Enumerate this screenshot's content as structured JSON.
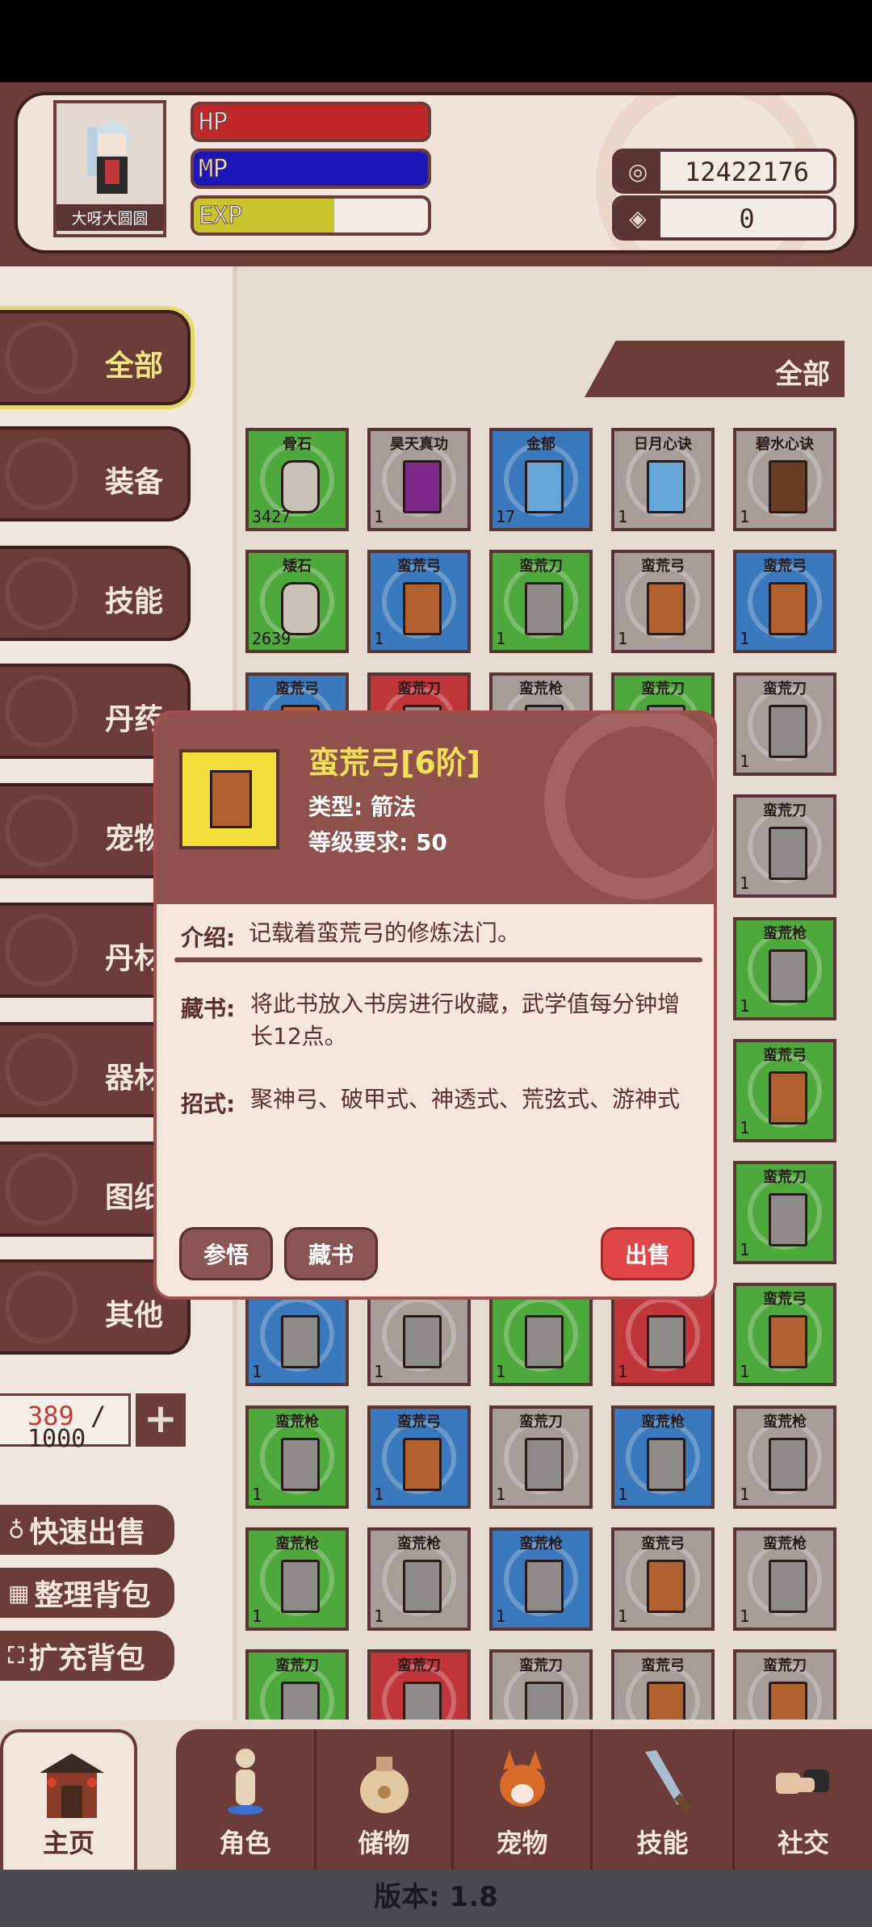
{
  "player": {
    "name": "大呀大圆圆",
    "hp_label": "HP",
    "hp_ratio": 1.0,
    "mp_label": "MP",
    "mp_ratio": 1.0,
    "exp_label": "EXP",
    "exp_ratio": 0.6,
    "coins": "12422176",
    "gems": "0"
  },
  "filter_label": "全部",
  "categories": [
    {
      "label": "全部"
    },
    {
      "label": "装备"
    },
    {
      "label": "技能"
    },
    {
      "label": "丹药"
    },
    {
      "label": "宠物"
    },
    {
      "label": "丹材"
    },
    {
      "label": "器材"
    },
    {
      "label": "图纸"
    },
    {
      "label": "其他"
    }
  ],
  "bag": {
    "used": "389",
    "max": "1000"
  },
  "side_buttons": [
    "快速出售",
    "整理背包",
    "扩充背包"
  ],
  "grid": [
    [
      {
        "name": "骨石",
        "qty": "3427",
        "c": "g",
        "book": "stone"
      },
      {
        "name": "昊天真功",
        "qty": "1",
        "c": "w",
        "book": "purple"
      },
      {
        "name": "金郁",
        "qty": "17",
        "c": "b",
        "book": "cyan"
      },
      {
        "name": "日月心诀",
        "qty": "1",
        "c": "w",
        "book": "cyan"
      },
      {
        "name": "碧水心诀",
        "qty": "1",
        "c": "w",
        "book": "dbrown"
      }
    ],
    [
      {
        "name": "矮石",
        "qty": "2639",
        "c": "g",
        "book": "stone"
      },
      {
        "name": "蛮荒弓",
        "qty": "1",
        "c": "b",
        "book": "brown"
      },
      {
        "name": "蛮荒刀",
        "qty": "1",
        "c": "g",
        "book": "grey"
      },
      {
        "name": "蛮荒弓",
        "qty": "1",
        "c": "w",
        "book": "brown"
      },
      {
        "name": "蛮荒弓",
        "qty": "1",
        "c": "b",
        "book": "brown"
      }
    ],
    [
      {
        "name": "蛮荒弓",
        "qty": "1",
        "c": "b",
        "book": "brown"
      },
      {
        "name": "蛮荒刀",
        "qty": "1",
        "c": "r",
        "book": "grey"
      },
      {
        "name": "蛮荒枪",
        "qty": "1",
        "c": "w",
        "book": "grey"
      },
      {
        "name": "蛮荒刀",
        "qty": "1",
        "c": "g",
        "book": "grey"
      },
      {
        "name": "蛮荒刀",
        "qty": "1",
        "c": "w",
        "book": "grey"
      }
    ],
    [
      {
        "name": "",
        "qty": "",
        "c": "w",
        "book": "grey"
      },
      {
        "name": "",
        "qty": "",
        "c": "w",
        "book": "grey"
      },
      {
        "name": "",
        "qty": "",
        "c": "w",
        "book": "grey"
      },
      {
        "name": "",
        "qty": "",
        "c": "w",
        "book": "grey"
      },
      {
        "name": "蛮荒刀",
        "qty": "1",
        "c": "w",
        "book": "grey"
      }
    ],
    [
      {
        "name": "",
        "qty": "",
        "c": "w",
        "book": "grey"
      },
      {
        "name": "",
        "qty": "",
        "c": "w",
        "book": "grey"
      },
      {
        "name": "",
        "qty": "",
        "c": "w",
        "book": "grey"
      },
      {
        "name": "",
        "qty": "",
        "c": "w",
        "book": "grey"
      },
      {
        "name": "蛮荒枪",
        "qty": "1",
        "c": "g",
        "book": "grey"
      }
    ],
    [
      {
        "name": "",
        "qty": "",
        "c": "w",
        "book": "grey"
      },
      {
        "name": "",
        "qty": "",
        "c": "w",
        "book": "grey"
      },
      {
        "name": "",
        "qty": "",
        "c": "w",
        "book": "grey"
      },
      {
        "name": "",
        "qty": "",
        "c": "w",
        "book": "grey"
      },
      {
        "name": "蛮荒弓",
        "qty": "1",
        "c": "g",
        "book": "brown"
      }
    ],
    [
      {
        "name": "",
        "qty": "",
        "c": "w",
        "book": "grey"
      },
      {
        "name": "",
        "qty": "",
        "c": "w",
        "book": "grey"
      },
      {
        "name": "",
        "qty": "",
        "c": "w",
        "book": "grey"
      },
      {
        "name": "",
        "qty": "",
        "c": "w",
        "book": "grey"
      },
      {
        "name": "蛮荒刀",
        "qty": "1",
        "c": "g",
        "book": "grey"
      }
    ],
    [
      {
        "name": "",
        "qty": "1",
        "c": "b",
        "book": "grey"
      },
      {
        "name": "",
        "qty": "1",
        "c": "w",
        "book": "grey"
      },
      {
        "name": "",
        "qty": "1",
        "c": "g",
        "book": "grey"
      },
      {
        "name": "",
        "qty": "1",
        "c": "r",
        "book": "grey"
      },
      {
        "name": "蛮荒弓",
        "qty": "1",
        "c": "g",
        "book": "brown"
      }
    ],
    [
      {
        "name": "蛮荒枪",
        "qty": "1",
        "c": "g",
        "book": "grey"
      },
      {
        "name": "蛮荒弓",
        "qty": "1",
        "c": "b",
        "book": "brown"
      },
      {
        "name": "蛮荒刀",
        "qty": "1",
        "c": "w",
        "book": "grey"
      },
      {
        "name": "蛮荒枪",
        "qty": "1",
        "c": "b",
        "book": "grey"
      },
      {
        "name": "蛮荒枪",
        "qty": "1",
        "c": "w",
        "book": "grey"
      }
    ],
    [
      {
        "name": "蛮荒枪",
        "qty": "1",
        "c": "g",
        "book": "grey"
      },
      {
        "name": "蛮荒枪",
        "qty": "1",
        "c": "w",
        "book": "grey"
      },
      {
        "name": "蛮荒枪",
        "qty": "1",
        "c": "b",
        "book": "grey"
      },
      {
        "name": "蛮荒弓",
        "qty": "1",
        "c": "w",
        "book": "brown"
      },
      {
        "name": "蛮荒枪",
        "qty": "1",
        "c": "w",
        "book": "grey"
      }
    ],
    [
      {
        "name": "蛮荒刀",
        "qty": "",
        "c": "g",
        "book": "grey"
      },
      {
        "name": "蛮荒刀",
        "qty": "",
        "c": "r",
        "book": "grey"
      },
      {
        "name": "蛮荒刀",
        "qty": "",
        "c": "w",
        "book": "grey"
      },
      {
        "name": "蛮荒弓",
        "qty": "",
        "c": "w",
        "book": "brown"
      },
      {
        "name": "蛮荒刀",
        "qty": "",
        "c": "w",
        "book": "brown"
      }
    ]
  ],
  "modal": {
    "title": "蛮荒弓[6阶]",
    "type": "类型: 箭法",
    "level_req": "等级要求: 50",
    "intro_label": "介绍:",
    "intro": "记载着蛮荒弓的修炼法门。",
    "collect_label": "藏书:",
    "collect": "将此书放入书房进行收藏，武学值每分钟增长12点。",
    "moves_label": "招式:",
    "moves": "聚神弓、破甲式、神透式、荒弦式、游神式",
    "btn_study": "参悟",
    "btn_collect": "藏书",
    "btn_sell": "出售"
  },
  "nav": [
    "主页",
    "角色",
    "储物",
    "宠物",
    "技能",
    "社交"
  ],
  "version": "版本: 1.8"
}
